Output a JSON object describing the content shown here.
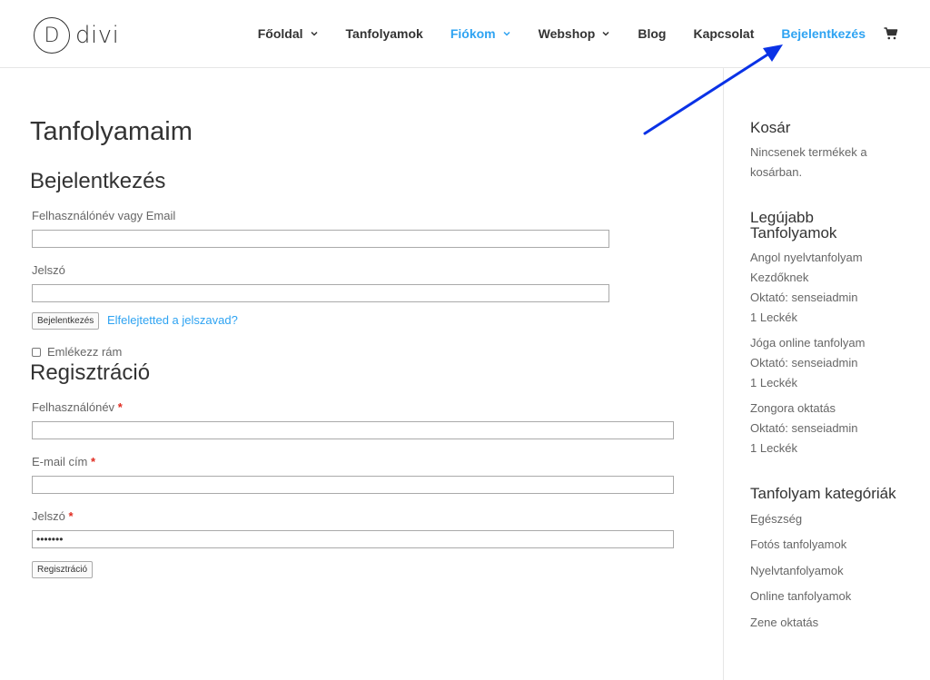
{
  "logo": {
    "letter": "D",
    "text": "divi"
  },
  "nav": {
    "items": [
      {
        "label": "Főoldal",
        "dropdown": true,
        "active": false
      },
      {
        "label": "Tanfolyamok",
        "dropdown": false,
        "active": false
      },
      {
        "label": "Fiókom",
        "dropdown": true,
        "active": true
      },
      {
        "label": "Webshop",
        "dropdown": true,
        "active": false
      },
      {
        "label": "Blog",
        "dropdown": false,
        "active": false
      },
      {
        "label": "Kapcsolat",
        "dropdown": false,
        "active": false
      },
      {
        "label": "Bejelentkezés",
        "dropdown": false,
        "active": true
      }
    ],
    "cart_icon": "shopping-cart-icon"
  },
  "main": {
    "page_title": "Tanfolyamaim",
    "login": {
      "title": "Bejelentkezés",
      "username_label": "Felhasználónév vagy Email",
      "username_value": "",
      "password_label": "Jelszó",
      "password_value": "",
      "submit_label": "Bejelentkezés",
      "forgot_link": "Elfelejtetted a jelszavad?",
      "remember_label": "Emlékezz rám",
      "remember_checked": false
    },
    "register": {
      "title": "Regisztráció",
      "username_label": "Felhasználónév",
      "email_label": "E-mail cím",
      "password_label": "Jelszó",
      "required_mark": "*",
      "username_value": "",
      "email_value": "",
      "password_value": "•••••••",
      "submit_label": "Regisztráció"
    }
  },
  "sidebar": {
    "cart": {
      "title": "Kosár",
      "empty_line1": "Nincsenek termékek a",
      "empty_line2": "kosárban."
    },
    "latest": {
      "title_line1": "Legújabb",
      "title_line2": "Tanfolyamok",
      "courses": [
        {
          "name_line1": "Angol nyelvtanfolyam",
          "name_line2": "Kezdőknek",
          "teacher": "Oktató: senseiadmin",
          "lessons": "1 Leckék"
        },
        {
          "name_line1": "Jóga online tanfolyam",
          "name_line2": "",
          "teacher": "Oktató: senseiadmin",
          "lessons": "1 Leckék"
        },
        {
          "name_line1": "Zongora oktatás",
          "name_line2": "",
          "teacher": "Oktató: senseiadmin",
          "lessons": "1 Leckék"
        }
      ]
    },
    "categories": {
      "title": "Tanfolyam kategóriák",
      "items": [
        "Egészség",
        "Fotós tanfolyamok",
        "Nyelvtanfolyamok",
        "Online tanfolyamok",
        "Zene oktatás"
      ]
    }
  },
  "colors": {
    "accent": "#2ea3f2",
    "annotation_arrow": "#0a32e6",
    "required": "#e02b20"
  }
}
